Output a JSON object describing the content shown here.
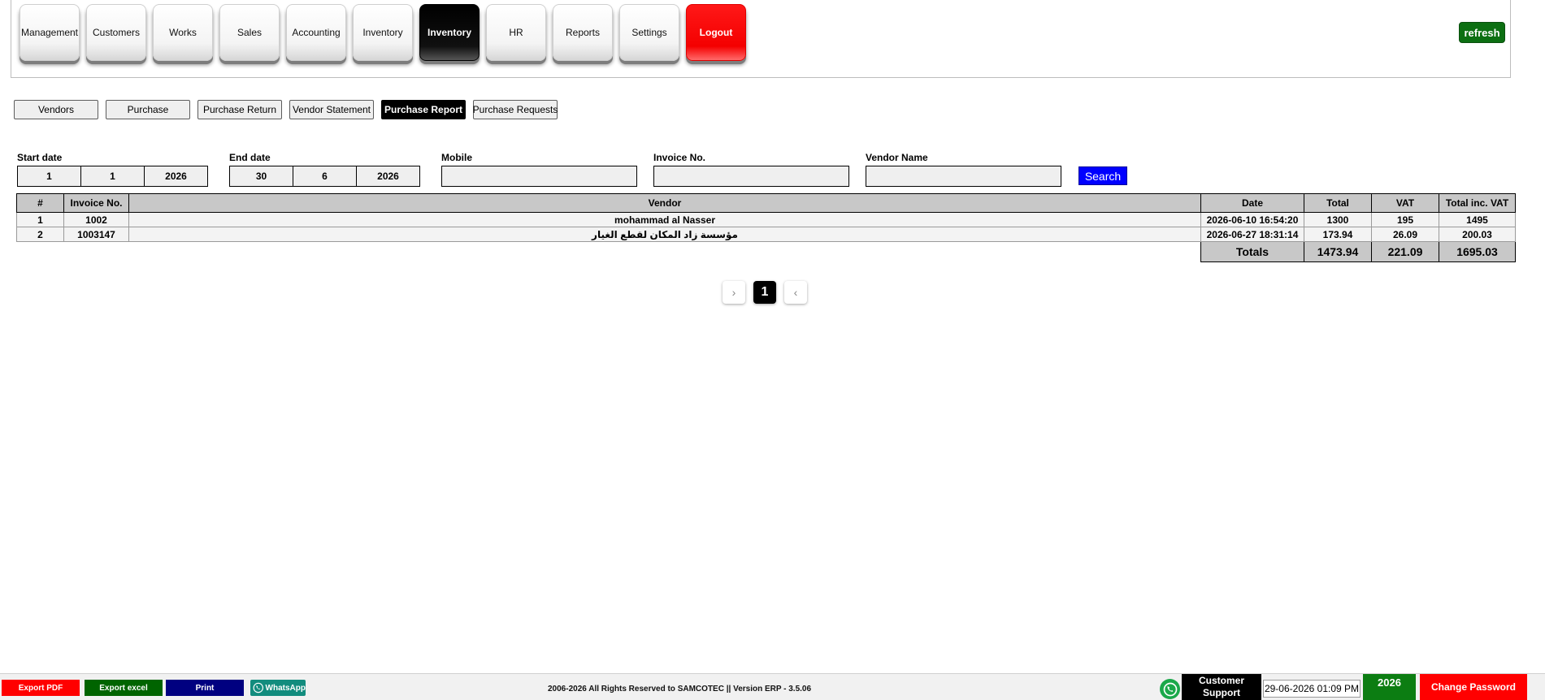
{
  "modules": [
    {
      "label": "Management"
    },
    {
      "label": "Customers"
    },
    {
      "label": "Works"
    },
    {
      "label": "Sales"
    },
    {
      "label": "Accounting"
    },
    {
      "label": "Inventory"
    },
    {
      "label": "Inventory"
    },
    {
      "label": "HR"
    },
    {
      "label": "Reports"
    },
    {
      "label": "Settings"
    },
    {
      "label": "Logout"
    }
  ],
  "refresh_label": "refresh",
  "subtabs": [
    {
      "label": "Vendors"
    },
    {
      "label": "Purchase"
    },
    {
      "label": "Purchase Return"
    },
    {
      "label": "Vendor Statement"
    },
    {
      "label": "Purchase Report"
    },
    {
      "label": "Purchase Requests"
    }
  ],
  "filters": {
    "start_label": "Start date",
    "start": {
      "day": "1",
      "month": "1",
      "year": "2026"
    },
    "end_label": "End date",
    "end": {
      "day": "30",
      "month": "6",
      "year": "2026"
    },
    "mobile_label": "Mobile",
    "mobile_value": "",
    "invoice_label": "Invoice No.",
    "invoice_value": "",
    "vendor_label": "Vendor Name",
    "vendor_value": "",
    "search_label": "Search"
  },
  "table": {
    "headers": {
      "num": "#",
      "invoice": "Invoice No.",
      "vendor": "Vendor",
      "date": "Date",
      "total": "Total",
      "vat": "VAT",
      "total_vat": "Total inc. VAT"
    },
    "rows": [
      {
        "num": "1",
        "invoice": "1002",
        "vendor": "mohammad al Nasser",
        "date": "2026-06-10 16:54:20",
        "total": "1300",
        "vat": "195",
        "total_vat": "1495"
      },
      {
        "num": "2",
        "invoice": "1003147",
        "vendor": "مؤسسة زاد المكان لقطع الغيار",
        "date": "2026-06-27 18:31:14",
        "total": "173.94",
        "vat": "26.09",
        "total_vat": "200.03"
      }
    ],
    "totals": {
      "label": "Totals",
      "total": "1473.94",
      "vat": "221.09",
      "total_vat": "1695.03"
    }
  },
  "pagination": {
    "prev": "›",
    "current": "1",
    "next": "‹"
  },
  "footer": {
    "export_pdf": "Export PDF",
    "export_excel": "Export excel",
    "print": "Print",
    "whatsapp": "WhatsApp",
    "copyright": "2006-2026 All Rights Reserved to SAMCOTEC || Version ERP - 3.5.06",
    "support_line1": "Customer",
    "support_line2": "Support",
    "clock": "29-06-2026 01:09 PM",
    "year": "2026",
    "change_password": "Change Password"
  },
  "colors": {
    "accent_blue": "#0000ff",
    "green": "#0c6f12",
    "red": "#ff0000",
    "header_gray": "#c8c8c8"
  }
}
